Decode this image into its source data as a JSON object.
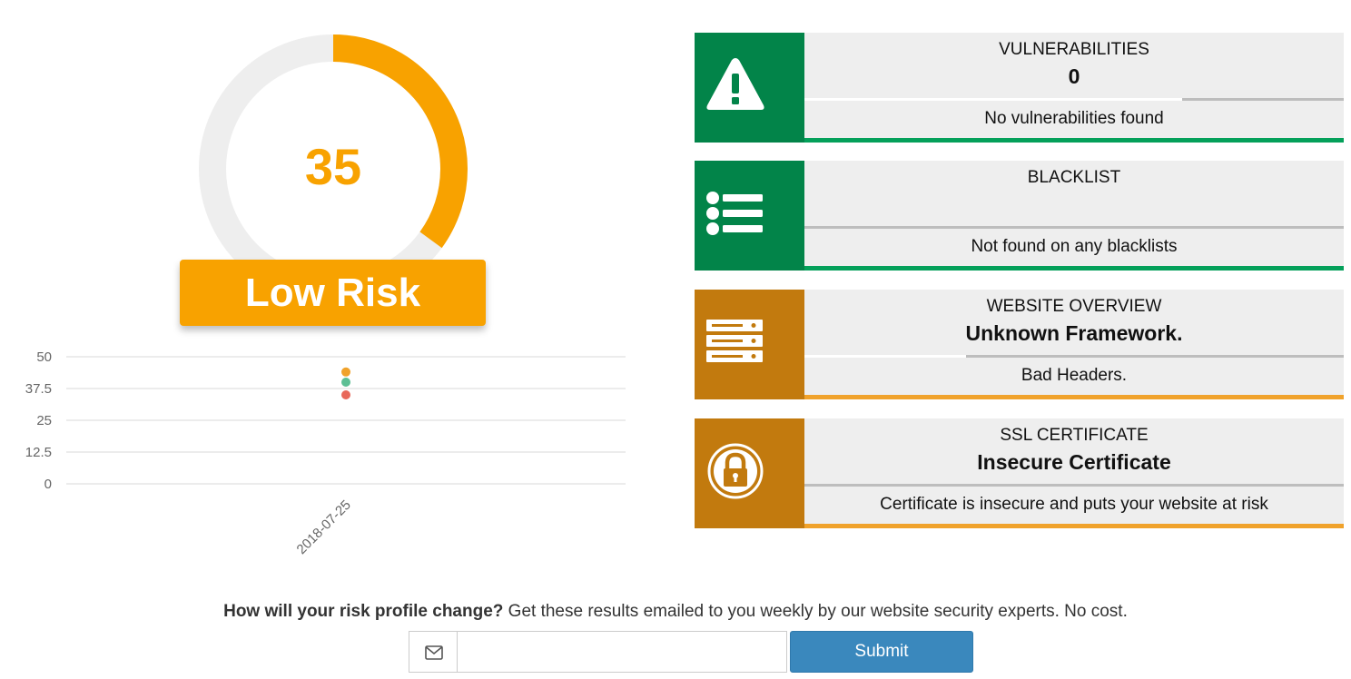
{
  "score": {
    "value": 35,
    "max": 100,
    "risk_label": "Low Risk",
    "color": "#f8a200",
    "track_color": "#eeeeee"
  },
  "chart_data": {
    "type": "scatter",
    "categories": [
      "2018-07-25"
    ],
    "yticks": [
      "50",
      "37.5",
      "25",
      "12.5",
      "0"
    ],
    "ylim": [
      0,
      50
    ],
    "grid": true,
    "series": [
      {
        "values": [
          44
        ],
        "color": "#f0a22b"
      },
      {
        "values": [
          40
        ],
        "color": "#5cbf94"
      },
      {
        "values": [
          35
        ],
        "color": "#e8685a"
      }
    ]
  },
  "cards": [
    {
      "title": "VULNERABILITIES",
      "value": "0",
      "description": "No vulnerabilities found",
      "status": "green",
      "icon": "warning-icon",
      "divider_fill": 0.7
    },
    {
      "title": "BLACKLIST",
      "value": "",
      "description": "Not found on any blacklists",
      "status": "green",
      "icon": "list-icon",
      "divider_fill": 0
    },
    {
      "title": "WEBSITE OVERVIEW",
      "value": "Unknown Framework.",
      "description": "Bad Headers.",
      "status": "orange",
      "icon": "server-icon",
      "divider_fill": 0.3
    },
    {
      "title": "SSL CERTIFICATE",
      "value": "Insecure Certificate",
      "description": "Certificate is insecure and puts your website at risk",
      "status": "orange",
      "icon": "lock-icon",
      "divider_fill": 0
    }
  ],
  "signup": {
    "question": "How will your risk profile change?",
    "text": " Get these results emailed to you weekly by our website security experts. No cost.",
    "email_value": "",
    "submit_label": "Submit"
  }
}
